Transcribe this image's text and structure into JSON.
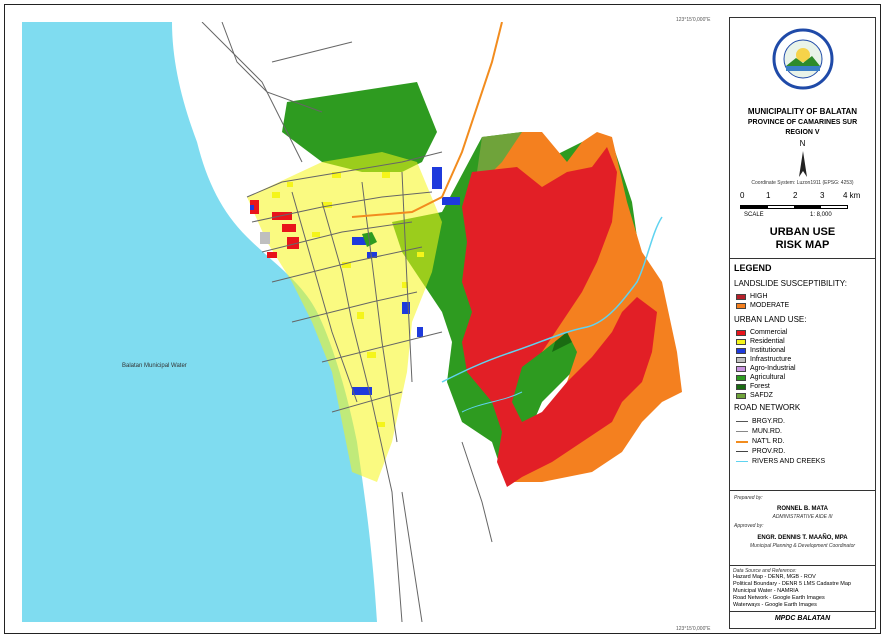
{
  "coords": {
    "top": "123°15'0,000\"E",
    "bottom": "123°15'0,000\"E"
  },
  "map": {
    "water_label": "Balatan Municipal Water",
    "colors": {
      "water": "#7fdcf0",
      "high": "#e21f26",
      "moderate": "#f4801f",
      "commercial": "#e8141b",
      "residential": "#f5f51a",
      "institutional": "#1e3adc",
      "infrastructure": "#bfbfbf",
      "agro_industrial": "#c893e0",
      "agricultural": "#2e9b20",
      "forest": "#1a6b12",
      "safdz": "#6fa33a",
      "road": "#666666",
      "national_road": "#f28c1e",
      "river": "#5fd3f0"
    }
  },
  "panel": {
    "seal_top_text": "BAYAN NG BALATAN",
    "seal_bottom_text": "CAMARINES SUR",
    "municipality": "MUNICIPALITY OF BALATAN",
    "province": "PROVINCE OF CAMARINES SUR",
    "region": "REGION V",
    "north": "N",
    "coord_system": "Coordinate System: Luzon1911 (EPSG: 4253)",
    "scale_ticks": [
      "0",
      "1",
      "2",
      "3",
      "4 km"
    ],
    "scale_label": "SCALE",
    "scale_ratio": "1: 8,000",
    "title_line1": "URBAN USE",
    "title_line2": "RISK MAP",
    "legend": {
      "heading": "LEGEND",
      "landslide_heading": "LANDSLIDE SUSCEPTIBILITY:",
      "landslide": [
        {
          "label": "HIGH",
          "color": "#b5202a"
        },
        {
          "label": "MODERATE",
          "color": "#f4801f"
        }
      ],
      "landuse_heading": "URBAN LAND USE:",
      "landuse": [
        {
          "label": "Commercial",
          "color": "#e8141b"
        },
        {
          "label": "Residential",
          "color": "#f5f51a"
        },
        {
          "label": "Institutional",
          "color": "#1e3adc"
        },
        {
          "label": "Infrastructure",
          "color": "#bfbfbf"
        },
        {
          "label": "Agro-Industrial",
          "color": "#c893e0"
        },
        {
          "label": "Agricultural",
          "color": "#2e9b20"
        },
        {
          "label": "Forest",
          "color": "#1a6b12"
        },
        {
          "label": "SAFDZ",
          "color": "#6fa33a"
        }
      ],
      "road_heading": "ROAD NETWORK",
      "roads": [
        {
          "label": "BRGY.RD.",
          "color": "#555555"
        },
        {
          "label": "MUN.RD.",
          "color": "#888888"
        },
        {
          "label": "NAT'L RD.",
          "color": "#f28c1e"
        },
        {
          "label": "PROV.RD.",
          "color": "#444444"
        },
        {
          "label": "RIVERS AND CREEKS",
          "color": "#5fd3f0"
        }
      ]
    },
    "prepared_by_label": "Prepared by:",
    "prepared_name": "RONNEL B. MATA",
    "prepared_title": "ADMINISTRATIVE AIDE III",
    "approved_by_label": "Approved by:",
    "approved_name": "ENGR. DENNIS T. MAAÑO, MPA",
    "approved_title": "Municipal Planning & Development Coordinator",
    "source_label": "Data Source and Reference:",
    "sources": [
      "Hazard Map - DENR, MGB - ROV",
      "Political Boundary - DENR 5 LMS Cadastre Map",
      "Municipal Water - NAMRIA",
      "Road Network - Google Earth Images",
      "Waterways - Google Earth Images"
    ],
    "footer": "MPDC BALATAN"
  }
}
